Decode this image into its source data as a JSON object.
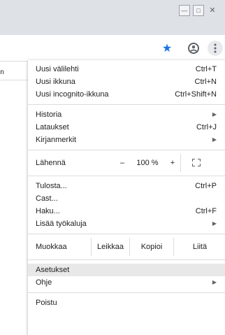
{
  "window": {
    "minimize_glyph": "—",
    "maximize_glyph": "□",
    "close_glyph": "✕"
  },
  "toolbar": {
    "icons": [
      "star-icon",
      "profile-icon",
      "more-vert-icon"
    ],
    "accent": "#1a73e8"
  },
  "page": {
    "partial_text": "in"
  },
  "menu": {
    "group1": [
      {
        "label": "Uusi välilehti",
        "shortcut": "Ctrl+T"
      },
      {
        "label": "Uusi ikkuna",
        "shortcut": "Ctrl+N"
      },
      {
        "label": "Uusi incognito-ikkuna",
        "shortcut": "Ctrl+Shift+N"
      }
    ],
    "group2": [
      {
        "label": "Historia",
        "shortcut": ""
      },
      {
        "label": "Lataukset",
        "shortcut": "Ctrl+J"
      },
      {
        "label": "Kirjanmerkit",
        "shortcut": ""
      }
    ],
    "zoom": {
      "label": "Lähennä",
      "minus": "–",
      "value": "100 %",
      "plus": "+"
    },
    "group3": [
      {
        "label": "Tulosta...",
        "shortcut": "Ctrl+P"
      },
      {
        "label": "Cast...",
        "shortcut": ""
      },
      {
        "label": "Haku...",
        "shortcut": "Ctrl+F"
      },
      {
        "label": "Lisää työkaluja",
        "shortcut": ""
      }
    ],
    "edit": {
      "label": "Muokkaa",
      "cut": "Leikkaa",
      "copy": "Kopioi",
      "paste": "Liitä"
    },
    "group4": [
      {
        "label": "Asetukset"
      },
      {
        "label": "Ohje"
      }
    ],
    "exit": "Poistu"
  }
}
